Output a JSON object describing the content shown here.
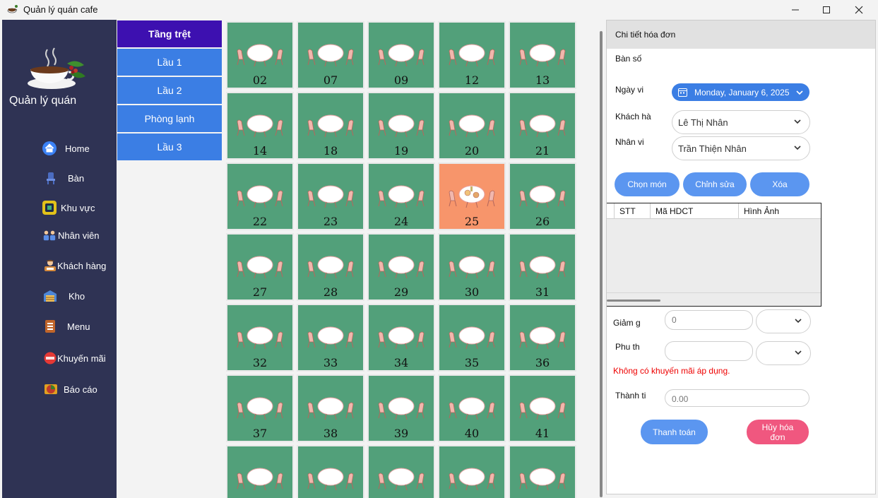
{
  "window": {
    "title": "Quản lý quán cafe"
  },
  "sidebar": {
    "brand": "Quản lý quán",
    "items": [
      {
        "label": "Home",
        "icon": "home-icon",
        "color": "#3b82f6"
      },
      {
        "label": "Bàn",
        "icon": "table-icon",
        "color": "#4b6cc1"
      },
      {
        "label": "Khu vực",
        "icon": "area-icon",
        "color": "#e2c21a"
      },
      {
        "label": "Nhân viên",
        "icon": "staff-icon",
        "color": "#5b8de6"
      },
      {
        "label": "Khách hàng",
        "icon": "customer-icon",
        "color": "#d58a3c"
      },
      {
        "label": "Kho",
        "icon": "warehouse-icon",
        "color": "#4d86d6"
      },
      {
        "label": "Menu",
        "icon": "menu-icon",
        "color": "#c0652a"
      },
      {
        "label": "Khuyến mãi",
        "icon": "sale-icon",
        "color": "#e53935"
      },
      {
        "label": "Báo cáo",
        "icon": "report-icon",
        "color": "#e0a020"
      }
    ]
  },
  "floors": [
    {
      "label": "Tầng trệt",
      "active": true
    },
    {
      "label": "Lầu 1",
      "active": false
    },
    {
      "label": "Lầu 2",
      "active": false
    },
    {
      "label": "Phòng lạnh",
      "active": false
    },
    {
      "label": "Lầu 3",
      "active": false
    }
  ],
  "tables": [
    {
      "number": "02",
      "status": "empty"
    },
    {
      "number": "07",
      "status": "empty"
    },
    {
      "number": "09",
      "status": "empty"
    },
    {
      "number": "12",
      "status": "empty"
    },
    {
      "number": "13",
      "status": "empty"
    },
    {
      "number": "14",
      "status": "empty"
    },
    {
      "number": "18",
      "status": "empty"
    },
    {
      "number": "19",
      "status": "empty"
    },
    {
      "number": "20",
      "status": "empty"
    },
    {
      "number": "21",
      "status": "empty"
    },
    {
      "number": "22",
      "status": "empty"
    },
    {
      "number": "23",
      "status": "empty"
    },
    {
      "number": "24",
      "status": "empty"
    },
    {
      "number": "25",
      "status": "occupied"
    },
    {
      "number": "26",
      "status": "empty"
    },
    {
      "number": "27",
      "status": "empty"
    },
    {
      "number": "28",
      "status": "empty"
    },
    {
      "number": "29",
      "status": "empty"
    },
    {
      "number": "30",
      "status": "empty"
    },
    {
      "number": "31",
      "status": "empty"
    },
    {
      "number": "32",
      "status": "empty"
    },
    {
      "number": "33",
      "status": "empty"
    },
    {
      "number": "34",
      "status": "empty"
    },
    {
      "number": "35",
      "status": "empty"
    },
    {
      "number": "36",
      "status": "empty"
    },
    {
      "number": "37",
      "status": "empty"
    },
    {
      "number": "38",
      "status": "empty"
    },
    {
      "number": "39",
      "status": "empty"
    },
    {
      "number": "40",
      "status": "empty"
    },
    {
      "number": "41",
      "status": "empty"
    },
    {
      "number": "",
      "status": "empty"
    },
    {
      "number": "",
      "status": "empty"
    },
    {
      "number": "",
      "status": "empty"
    },
    {
      "number": "",
      "status": "empty"
    },
    {
      "number": "",
      "status": "empty"
    }
  ],
  "colors": {
    "table_empty": "#52a07a",
    "table_occupied": "#f7956b",
    "floor_active": "#3d10b0",
    "floor": "#3b7ee4",
    "sidebar": "#2f3354",
    "button": "#5b96f0",
    "cancel_button": "#f0577f"
  },
  "invoice": {
    "header": "Chi tiết hóa đơn",
    "table_label": "Bàn số",
    "date_label": "Ngày vi",
    "date_value": "Monday, January 6, 2025",
    "customer_label": "Khách hà",
    "customer_value": "Lê Thị Nhân",
    "staff_label": "Nhân vi",
    "staff_value": "Trần Thiện Nhân",
    "buttons": {
      "choose": "Chọn món",
      "edit": "Chỉnh sửa",
      "delete": "Xóa"
    },
    "columns": [
      "STT",
      "Mã HDCT",
      "Hình Ảnh"
    ],
    "discount_label": "Giảm g",
    "discount_value": "0",
    "surcharge_label": "Phu th",
    "surcharge_value": "",
    "promo_message": "Không có khuyến mãi áp dụng.",
    "total_label": "Thành ti",
    "total_value": "0.00",
    "pay_button": "Thanh toán",
    "cancel_button": "Hủy hóa đơn"
  }
}
